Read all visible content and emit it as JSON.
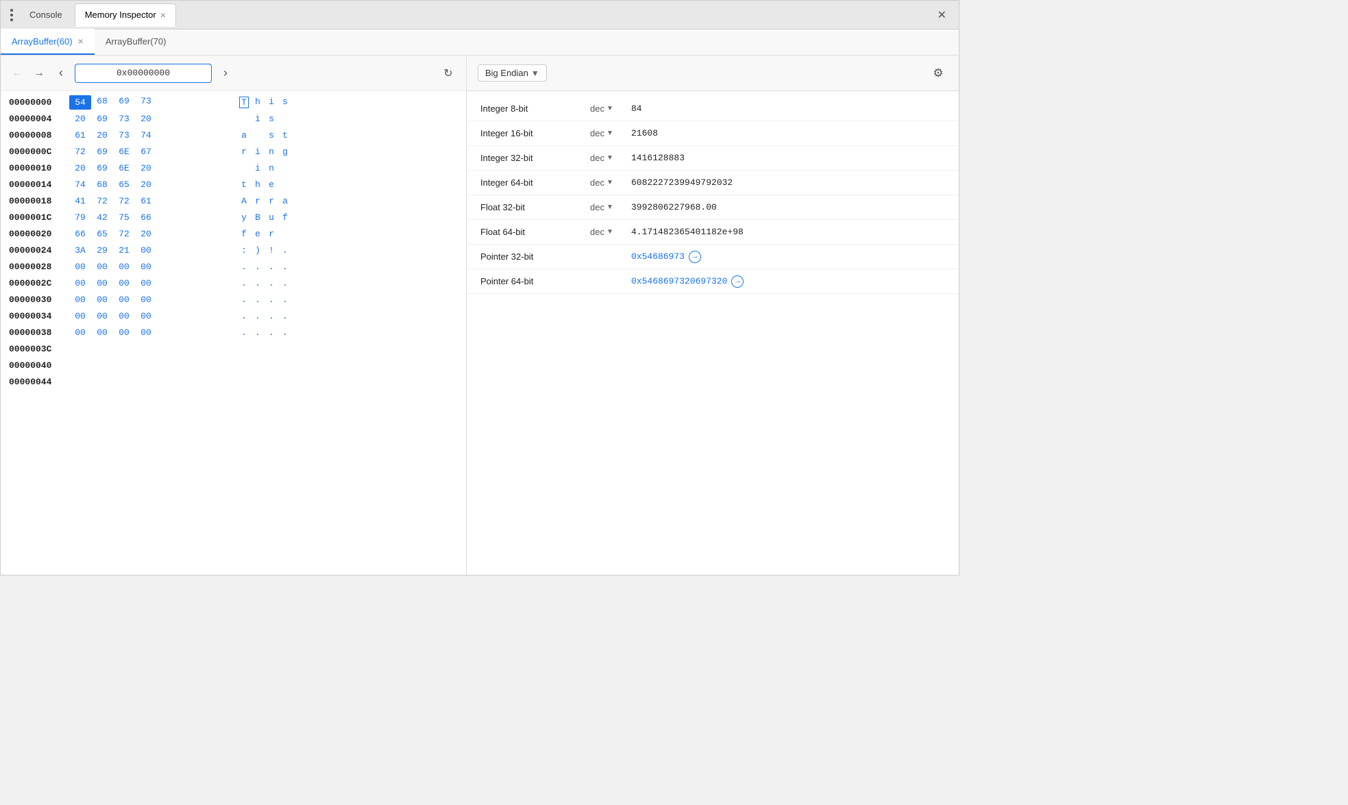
{
  "window": {
    "title": "Memory Inspector",
    "close_label": "✕"
  },
  "top_tabs": [
    {
      "id": "console",
      "label": "Console",
      "active": false,
      "closable": false
    },
    {
      "id": "memory",
      "label": "Memory Inspector",
      "active": true,
      "closable": true
    }
  ],
  "buffer_tabs": [
    {
      "id": "buf60",
      "label": "ArrayBuffer(60)",
      "active": true,
      "closable": true
    },
    {
      "id": "buf70",
      "label": "ArrayBuffer(70)",
      "active": false,
      "closable": false
    }
  ],
  "nav": {
    "address": "0x00000000",
    "back_disabled": true,
    "forward_disabled": false
  },
  "hex_rows": [
    {
      "address": "00000000",
      "bytes": [
        "54",
        "68",
        "69",
        "73"
      ],
      "ascii": [
        "T",
        "h",
        "i",
        "s"
      ],
      "selected_byte": 0
    },
    {
      "address": "00000004",
      "bytes": [
        "20",
        "69",
        "73",
        "20"
      ],
      "ascii": [
        " ",
        "i",
        "s",
        " "
      ]
    },
    {
      "address": "00000008",
      "bytes": [
        "61",
        "20",
        "73",
        "74"
      ],
      "ascii": [
        "a",
        " ",
        "s",
        "t"
      ]
    },
    {
      "address": "0000000C",
      "bytes": [
        "72",
        "69",
        "6E",
        "67"
      ],
      "ascii": [
        "r",
        "i",
        "n",
        "g"
      ]
    },
    {
      "address": "00000010",
      "bytes": [
        "20",
        "69",
        "6E",
        "20"
      ],
      "ascii": [
        " ",
        "i",
        "n",
        " "
      ]
    },
    {
      "address": "00000014",
      "bytes": [
        "74",
        "68",
        "65",
        "20"
      ],
      "ascii": [
        "t",
        "h",
        "e",
        " "
      ]
    },
    {
      "address": "00000018",
      "bytes": [
        "41",
        "72",
        "72",
        "61"
      ],
      "ascii": [
        "A",
        "r",
        "r",
        "a"
      ]
    },
    {
      "address": "0000001C",
      "bytes": [
        "79",
        "42",
        "75",
        "66"
      ],
      "ascii": [
        "y",
        "B",
        "u",
        "f"
      ]
    },
    {
      "address": "00000020",
      "bytes": [
        "66",
        "65",
        "72",
        "20"
      ],
      "ascii": [
        "f",
        "e",
        "r",
        " "
      ]
    },
    {
      "address": "00000024",
      "bytes": [
        "3A",
        "29",
        "21",
        "00"
      ],
      "ascii": [
        ":",
        ")",
        "!",
        "."
      ]
    },
    {
      "address": "00000028",
      "bytes": [
        "00",
        "00",
        "00",
        "00"
      ],
      "ascii": [
        ".",
        ".",
        ".",
        "."
      ]
    },
    {
      "address": "0000002C",
      "bytes": [
        "00",
        "00",
        "00",
        "00"
      ],
      "ascii": [
        ".",
        ".",
        ".",
        "."
      ]
    },
    {
      "address": "00000030",
      "bytes": [
        "00",
        "00",
        "00",
        "00"
      ],
      "ascii": [
        ".",
        ".",
        ".",
        "."
      ]
    },
    {
      "address": "00000034",
      "bytes": [
        "00",
        "00",
        "00",
        "00"
      ],
      "ascii": [
        ".",
        ".",
        ".",
        "."
      ]
    },
    {
      "address": "00000038",
      "bytes": [
        "00",
        "00",
        "00",
        "00"
      ],
      "ascii": [
        ".",
        ".",
        ".",
        "."
      ]
    },
    {
      "address": "0000003C",
      "bytes": [],
      "ascii": [],
      "empty": true
    },
    {
      "address": "00000040",
      "bytes": [],
      "ascii": [],
      "empty": true
    },
    {
      "address": "00000044",
      "bytes": [],
      "ascii": [],
      "empty": true
    }
  ],
  "value_panel": {
    "endian": "Big Endian",
    "rows": [
      {
        "label": "Integer 8-bit",
        "format": "dec",
        "value": "84",
        "is_pointer": false
      },
      {
        "label": "Integer 16-bit",
        "format": "dec",
        "value": "21608",
        "is_pointer": false
      },
      {
        "label": "Integer 32-bit",
        "format": "dec",
        "value": "1416128883",
        "is_pointer": false
      },
      {
        "label": "Integer 64-bit",
        "format": "dec",
        "value": "6082227239949792032",
        "is_pointer": false
      },
      {
        "label": "Float 32-bit",
        "format": "dec",
        "value": "3992806227968.00",
        "is_pointer": false
      },
      {
        "label": "Float 64-bit",
        "format": "dec",
        "value": "4.171482365401182e+98",
        "is_pointer": false
      },
      {
        "label": "Pointer 32-bit",
        "format": "",
        "value": "0x54686973",
        "is_pointer": true
      },
      {
        "label": "Pointer 64-bit",
        "format": "",
        "value": "0x5468697320697320",
        "is_pointer": true
      }
    ]
  }
}
